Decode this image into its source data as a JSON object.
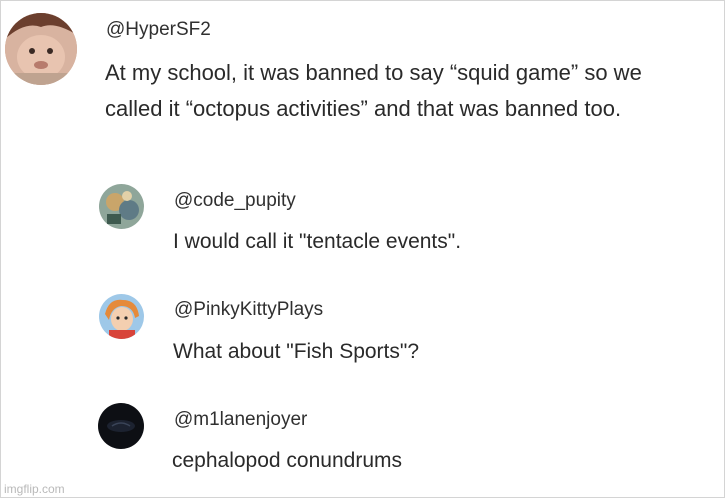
{
  "comment": {
    "handle": "@HyperSF2",
    "text": "At my school, it was banned to say “squid game” so we called it “octopus activities” and that was banned too."
  },
  "replies": [
    {
      "handle": "@code_pupity",
      "text": "I would call it \"tentacle events\"."
    },
    {
      "handle": "@PinkyKittyPlays",
      "text": "What about \"Fish Sports\"?"
    },
    {
      "handle": "@m1lanenjoyer",
      "text": "cephalopod conundrums"
    }
  ],
  "watermark": "imgflip.com"
}
